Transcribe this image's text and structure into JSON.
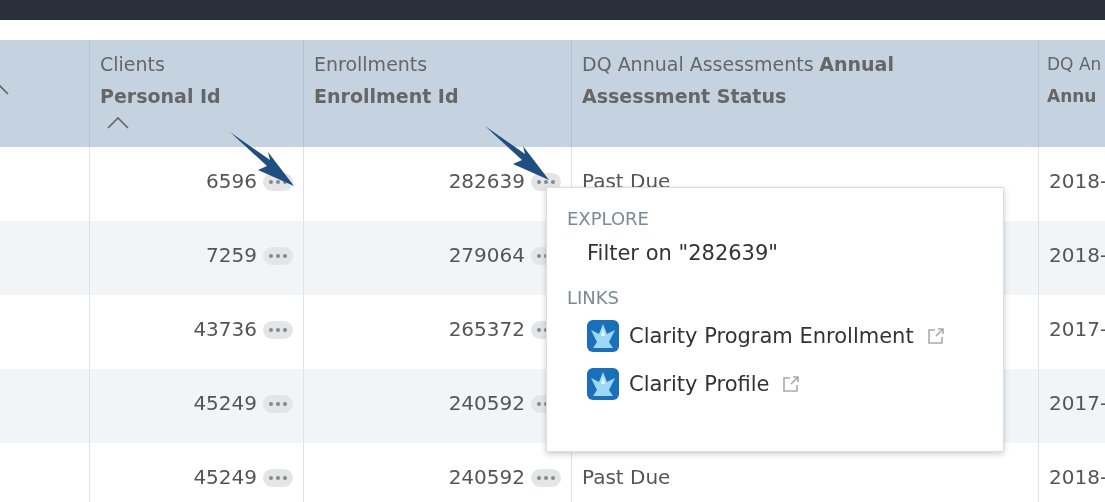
{
  "table": {
    "columns": [
      {
        "sorted": true
      },
      {
        "group": "Clients",
        "field": "Personal Id",
        "sorted": true
      },
      {
        "group": "Enrollments",
        "field": "Enrollment Id",
        "sorted": false
      },
      {
        "group": "DQ Annual Assessments",
        "field": "Annual Assessment Status",
        "sorted": false
      },
      {
        "group": "DQ An",
        "field": "Annu",
        "sorted": false
      }
    ],
    "rows": [
      {
        "personal_id": "6596",
        "enrollment_id": "282639",
        "status": "Past Due",
        "date": "2018-"
      },
      {
        "personal_id": "7259",
        "enrollment_id": "279064",
        "date": "2018-"
      },
      {
        "personal_id": "43736",
        "enrollment_id": "265372",
        "date": "2017-"
      },
      {
        "personal_id": "45249",
        "enrollment_id": "240592",
        "date": "2017-"
      },
      {
        "personal_id": "45249",
        "enrollment_id": "240592",
        "status": "Past Due",
        "date": "2018-"
      }
    ]
  },
  "menu": {
    "sections": [
      {
        "heading": "EXPLORE",
        "items": [
          {
            "kind": "action",
            "label": "Filter on \"282639\""
          }
        ]
      },
      {
        "heading": "LINKS",
        "items": [
          {
            "kind": "link",
            "label": "Clarity Program Enrollment"
          },
          {
            "kind": "link",
            "label": "Clarity Profile"
          }
        ]
      }
    ]
  }
}
